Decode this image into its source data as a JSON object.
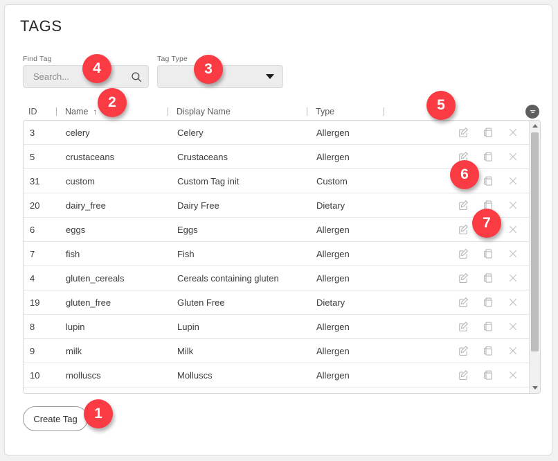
{
  "page": {
    "title": "TAGS"
  },
  "filters": {
    "find_tag": {
      "label": "Find Tag",
      "value": "",
      "placeholder": "Search...",
      "icon": "search-icon"
    },
    "tag_type": {
      "label": "Tag Type",
      "value": "",
      "icon": "chevron-down-icon"
    }
  },
  "table": {
    "columns": [
      {
        "key": "id",
        "label": "ID"
      },
      {
        "key": "name",
        "label": "Name",
        "sort": "ascending",
        "sort_glyph": "↑"
      },
      {
        "key": "display_name",
        "label": "Display Name"
      },
      {
        "key": "type",
        "label": "Type"
      }
    ],
    "filter_icon": "filter-icon",
    "row_actions": [
      {
        "name": "edit-icon",
        "label": "Edit"
      },
      {
        "name": "duplicate-icon",
        "label": "Duplicate"
      },
      {
        "name": "delete-icon",
        "label": "Delete"
      }
    ],
    "rows": [
      {
        "id": "3",
        "name": "celery",
        "display_name": "Celery",
        "type": "Allergen"
      },
      {
        "id": "5",
        "name": "crustaceans",
        "display_name": "Crustaceans",
        "type": "Allergen"
      },
      {
        "id": "31",
        "name": "custom",
        "display_name": "Custom Tag init",
        "type": "Custom"
      },
      {
        "id": "20",
        "name": "dairy_free",
        "display_name": "Dairy Free",
        "type": "Dietary"
      },
      {
        "id": "6",
        "name": "eggs",
        "display_name": "Eggs",
        "type": "Allergen"
      },
      {
        "id": "7",
        "name": "fish",
        "display_name": "Fish",
        "type": "Allergen"
      },
      {
        "id": "4",
        "name": "gluten_cereals",
        "display_name": "Cereals containing gluten",
        "type": "Allergen"
      },
      {
        "id": "19",
        "name": "gluten_free",
        "display_name": "Gluten Free",
        "type": "Dietary"
      },
      {
        "id": "8",
        "name": "lupin",
        "display_name": "Lupin",
        "type": "Allergen"
      },
      {
        "id": "9",
        "name": "milk",
        "display_name": "Milk",
        "type": "Allergen"
      },
      {
        "id": "10",
        "name": "molluscs",
        "display_name": "Molluscs",
        "type": "Allergen"
      },
      {
        "id": "",
        "name": "",
        "display_name": "",
        "type": ""
      }
    ]
  },
  "footer": {
    "create_button": "Create Tag"
  },
  "annotations": [
    {
      "number": "1",
      "target": "create-tag-button"
    },
    {
      "number": "2",
      "target": "name-column-header"
    },
    {
      "number": "3",
      "target": "tag-type-select"
    },
    {
      "number": "4",
      "target": "find-tag-search-input"
    },
    {
      "number": "5",
      "target": "row-edit-action"
    },
    {
      "number": "6",
      "target": "row-duplicate-action"
    },
    {
      "number": "7",
      "target": "row-delete-action"
    }
  ],
  "colors": {
    "badge": "#fa3b43",
    "card_background": "#ffffff",
    "page_background": "#f2f2f2",
    "field_background": "#ededed"
  }
}
